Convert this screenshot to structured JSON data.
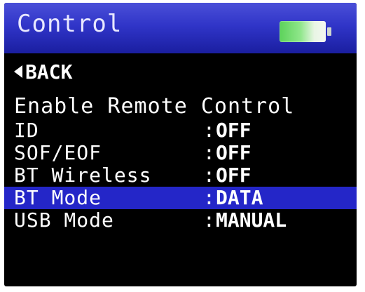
{
  "header": {
    "title": "Control",
    "battery_icon": "battery-full-icon",
    "battery_level": 1.0
  },
  "nav": {
    "back_label": "BACK",
    "back_icon": "triangle-left-icon"
  },
  "section": {
    "heading": "Enable Remote Control"
  },
  "settings": [
    {
      "label": "ID",
      "separator": ":",
      "value": "OFF"
    },
    {
      "label": "SOF/EOF",
      "separator": ":",
      "value": "OFF"
    },
    {
      "label": "BT Wireless",
      "separator": ":",
      "value": "OFF"
    },
    {
      "label": "BT Mode",
      "separator": ":",
      "value": "DATA",
      "selected": true
    },
    {
      "label": "USB Mode",
      "separator": ":",
      "value": "MANUAL"
    }
  ],
  "colors": {
    "title_bar": "#3035c8",
    "selection": "#2426c8",
    "background": "#000000",
    "battery": "#5cd25a"
  }
}
